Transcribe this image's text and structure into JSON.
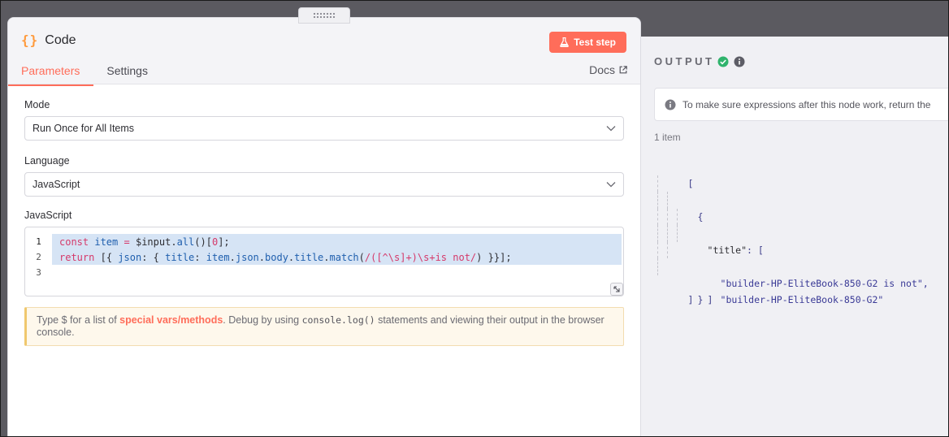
{
  "node": {
    "icon": "{}",
    "title": "Code",
    "test_step_label": "Test step",
    "tabs": [
      {
        "label": "Parameters",
        "active": true
      },
      {
        "label": "Settings",
        "active": false
      }
    ],
    "docs_label": "Docs"
  },
  "params": {
    "mode_label": "Mode",
    "mode_value": "Run Once for All Items",
    "language_label": "Language",
    "language_value": "JavaScript",
    "code_label": "JavaScript",
    "code_lines": [
      {
        "no": "1",
        "text": "const item = $input.all()[0];"
      },
      {
        "no": "2",
        "text": "return [{ json: { title: item.json.body.title.match(/([^\\s]+)\\s+is not/) }}];"
      },
      {
        "no": "3",
        "text": ""
      }
    ],
    "hint": {
      "prefix": "Type ",
      "dollar": "$",
      "mid": " for a list of ",
      "link": "special vars/methods",
      "after_link": ". Debug by using ",
      "code": "console.log()",
      "suffix": " statements and viewing their output in the browser console."
    }
  },
  "output": {
    "title": "OUTPUT",
    "notice": "To make sure expressions after this node work, return the",
    "items_count": "1 item",
    "json": {
      "open_bracket": "[",
      "open_brace": "{",
      "key": "\"title\"",
      "colon_bracket": ": [",
      "values": [
        "\"builder-HP-EliteBook-850-G2 is not\",",
        "\"builder-HP-EliteBook-850-G2\""
      ],
      "close_inner_bracket": "]",
      "close_brace": "}",
      "close_bracket": "]"
    }
  },
  "colors": {
    "accent": "#ff6d5a",
    "success": "#2fb36c",
    "selection": "#d6e4f5"
  }
}
